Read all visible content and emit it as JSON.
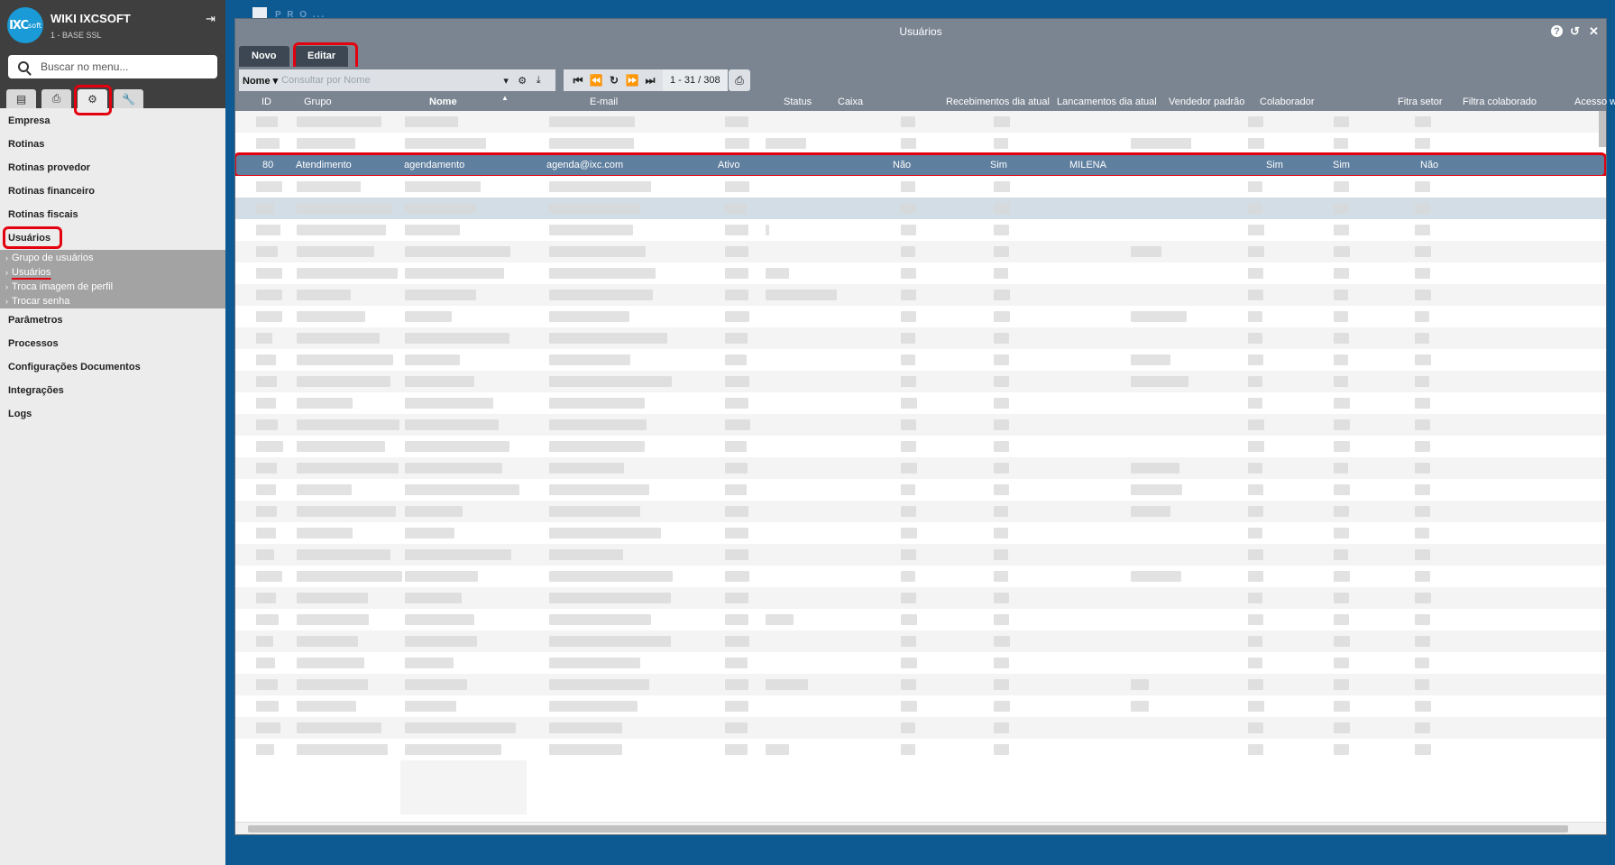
{
  "sidebar": {
    "brand": "WIKI IXCSOFT",
    "base": "1 - BASE SSL",
    "logo_text": "IXC",
    "logo_sub": "soft",
    "search_placeholder": "Buscar no menu...",
    "tabs": [
      "grid-icon",
      "print-icon",
      "gears-icon",
      "wrench-icon"
    ],
    "menu": [
      "Empresa",
      "Rotinas",
      "Rotinas provedor",
      "Rotinas financeiro",
      "Rotinas fiscais",
      "Usuários"
    ],
    "submenu": [
      "Grupo de usuários",
      "Usuários",
      "Troca imagem de perfil",
      "Trocar senha"
    ],
    "menu_after": [
      "Parâmetros",
      "Processos",
      "Configurações Documentos",
      "Integrações",
      "Logs"
    ]
  },
  "background": {
    "title": "P R O ..."
  },
  "window": {
    "title": "Usuários",
    "buttons": {
      "new": "Novo",
      "edit": "Editar"
    },
    "filter": {
      "field": "Nome",
      "placeholder": "Consultar por Nome"
    },
    "pager": {
      "count": "1 - 31 / 308"
    },
    "columns": [
      "ID",
      "Grupo",
      "Nome",
      "E-mail",
      "Status",
      "Caixa",
      "Recebimentos dia atual",
      "Lancamentos dia atual",
      "Vendedor padrão",
      "Colaborador",
      "Fitra setor",
      "Filtra colaborado",
      "Acesso webse"
    ],
    "selected_row": {
      "id": "80",
      "grupo": "Atendimento",
      "nome": "agendamento",
      "email": "agenda@ixc.com",
      "status": "Ativo",
      "caixa": "",
      "recebimentos": "Não",
      "lancamentos": "Sim",
      "vendedor": "MILENA",
      "colaborador": "",
      "filtra_setor": "Sim",
      "filtra_colaborador": "Sim",
      "acesso": "Não"
    }
  },
  "colors": {
    "accent": "#0d5a93",
    "header": "#7b8591",
    "selected_row": "#5f7f9f",
    "highlight": "#e3000f"
  }
}
